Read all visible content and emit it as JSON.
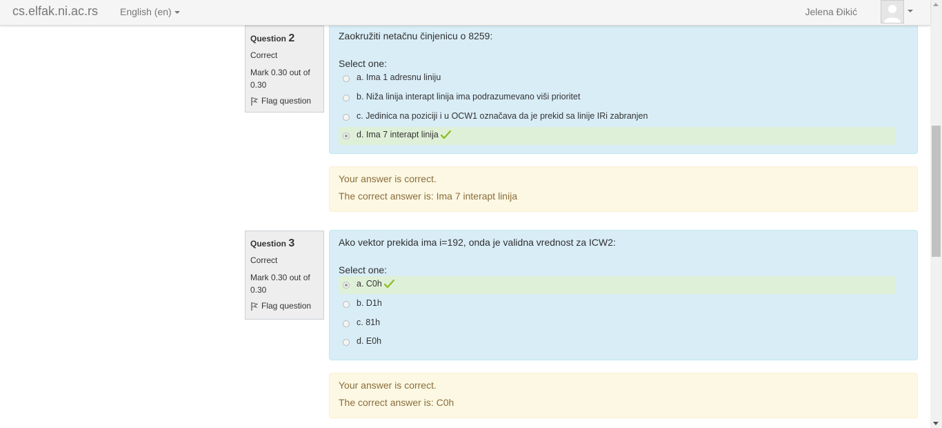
{
  "navbar": {
    "brand": "cs.elfak.ni.ac.rs",
    "language": "English (en)",
    "user_name": "Jelena Đikić"
  },
  "questions": [
    {
      "label": "Question",
      "number": "2",
      "state": "Correct",
      "grade": "Mark 0.30 out of 0.30",
      "flag": "Flag question",
      "text": "Zaokružiti netačnu činjenicu o 8259:",
      "prompt": "Select one:",
      "answers": [
        {
          "text": "a. Ima 1 adresnu liniju",
          "selected": false,
          "correct": false
        },
        {
          "text": "b. Niža linija interapt linija ima podrazumevano viši prioritet",
          "selected": false,
          "correct": false
        },
        {
          "text": "c. Jedinica na poziciji i u OCW1 označava da je prekid sa linije IRi zabranjen",
          "selected": false,
          "correct": false
        },
        {
          "text": "d. Ima 7 interapt linija",
          "selected": true,
          "correct": true
        }
      ],
      "feedback": "Your answer is correct.",
      "right_answer": "The correct answer is: Ima 7 interapt linija"
    },
    {
      "label": "Question",
      "number": "3",
      "state": "Correct",
      "grade": "Mark 0.30 out of 0.30",
      "flag": "Flag question",
      "text": "Ako vektor prekida ima i=192, onda je validna vrednost za ICW2:",
      "prompt": "Select one:",
      "answers": [
        {
          "text": "a. C0h",
          "selected": true,
          "correct": true
        },
        {
          "text": "b. D1h",
          "selected": false,
          "correct": false
        },
        {
          "text": "c. 81h",
          "selected": false,
          "correct": false
        },
        {
          "text": "d. E0h",
          "selected": false,
          "correct": false
        }
      ],
      "feedback": "Your answer is correct.",
      "right_answer": "The correct answer is: C0h"
    }
  ],
  "colors": {
    "formulation_bg": "#d9edf7",
    "correct_bg": "#dff0d8",
    "outcome_bg": "#fcf8e3",
    "check": "#8fbe29"
  }
}
